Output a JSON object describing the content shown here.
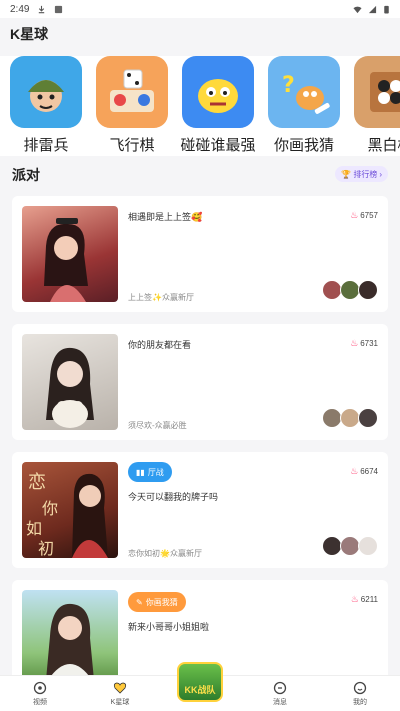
{
  "status": {
    "time": "2:49"
  },
  "app": {
    "title": "K星球"
  },
  "games": [
    {
      "label": "排雷兵",
      "icon": "soldier-game-icon",
      "bg": "#3fa7e8"
    },
    {
      "label": "飞行棋",
      "icon": "ludo-game-icon",
      "bg": "#f6a35a"
    },
    {
      "label": "碰碰谁最强",
      "icon": "bumper-game-icon",
      "bg": "#3d8bf2"
    },
    {
      "label": "你画我猜",
      "icon": "draw-guess-game-icon",
      "bg": "#6cb5f0"
    },
    {
      "label": "黑白棋",
      "icon": "reversi-game-icon",
      "bg": "#d9a06a"
    }
  ],
  "party": {
    "title": "派对",
    "rank_label": "排行榜"
  },
  "rooms": [
    {
      "title": "相遇即是上上签🥰",
      "sub": "上上签✨众赢新厅",
      "heat": "6757",
      "tag": "",
      "thumb_bg": "#b04a4a"
    },
    {
      "title": "你的朋友都在看",
      "sub": "须尽欢-众赢必胜",
      "heat": "6731",
      "tag": "",
      "thumb_bg": "#cfcac4"
    },
    {
      "title": "今天可以翻我的牌子吗",
      "sub": "恋你如初🌟众赢新厅",
      "heat": "6674",
      "tag": "厅战",
      "tag_bg": "#2f9cf0",
      "thumb_bg": "#8a3a2a"
    },
    {
      "title": "新来小哥哥小姐姐啦",
      "sub": "",
      "heat": "6211",
      "tag": "你画我猜",
      "tag_bg": "#ff9a3c",
      "thumb_bg": "#86b36a"
    }
  ],
  "tabs": [
    {
      "label": "视频",
      "icon": "video-tab-icon"
    },
    {
      "label": "K星球",
      "icon": "planet-tab-icon"
    },
    {
      "label": "",
      "icon": "kk-center-icon"
    },
    {
      "label": "消息",
      "icon": "message-tab-icon"
    },
    {
      "label": "我的",
      "icon": "profile-tab-icon"
    }
  ],
  "center_badge": "KK战队"
}
